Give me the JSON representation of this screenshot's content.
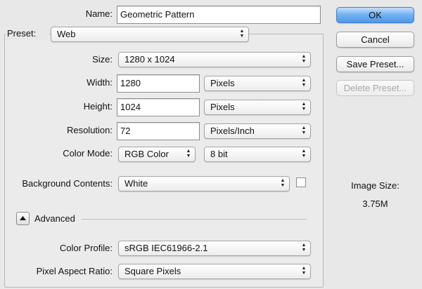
{
  "dialog": {
    "name_label": "Name:",
    "name_value": "Geometric Pattern",
    "preset_label": "Preset:",
    "preset_value": "Web",
    "size_label": "Size:",
    "size_value": "1280 x 1024",
    "width_label": "Width:",
    "width_value": "1280",
    "width_unit": "Pixels",
    "height_label": "Height:",
    "height_value": "1024",
    "height_unit": "Pixels",
    "resolution_label": "Resolution:",
    "resolution_value": "72",
    "resolution_unit": "Pixels/Inch",
    "color_mode_label": "Color Mode:",
    "color_mode_value": "RGB Color",
    "bit_depth_value": "8 bit",
    "background_label": "Background Contents:",
    "background_value": "White",
    "advanced_label": "Advanced",
    "color_profile_label": "Color Profile:",
    "color_profile_value": "sRGB IEC61966-2.1",
    "pixel_aspect_label": "Pixel Aspect Ratio:",
    "pixel_aspect_value": "Square Pixels"
  },
  "buttons": {
    "ok": "OK",
    "cancel": "Cancel",
    "save_preset": "Save Preset...",
    "delete_preset": "Delete Preset..."
  },
  "image_size": {
    "label": "Image Size:",
    "value": "3.75M"
  },
  "icons": {
    "select_arrows": "updown-chevron-icon",
    "advanced_toggle": "triangle-up-icon"
  },
  "colors": {
    "primary_button": "#5aa2ee",
    "background": "#e8e8e8"
  }
}
